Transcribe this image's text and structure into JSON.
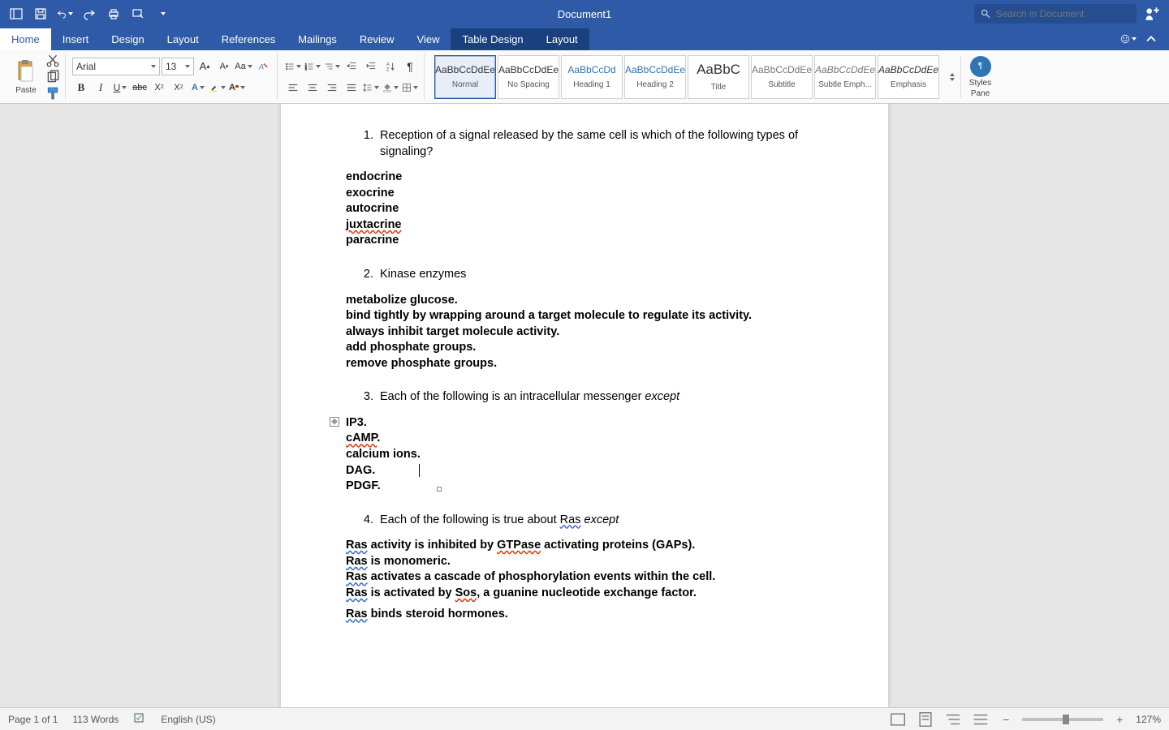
{
  "titlebar": {
    "document_title": "Document1",
    "search_placeholder": "Search in Document"
  },
  "tabs": {
    "home": "Home",
    "insert": "Insert",
    "design": "Design",
    "layout": "Layout",
    "references": "References",
    "mailings": "Mailings",
    "review": "Review",
    "view": "View",
    "table_design": "Table Design",
    "table_layout": "Layout"
  },
  "ribbon": {
    "paste_label": "Paste",
    "font_name": "Arial",
    "font_size": "13",
    "styles": [
      {
        "sample": "AaBbCcDdEe",
        "name": "Normal",
        "class": "",
        "selected": true
      },
      {
        "sample": "AaBbCcDdEe",
        "name": "No Spacing",
        "class": "",
        "selected": false
      },
      {
        "sample": "AaBbCcDd",
        "name": "Heading 1",
        "class": "h",
        "selected": false
      },
      {
        "sample": "AaBbCcDdEe",
        "name": "Heading 2",
        "class": "h",
        "selected": false
      },
      {
        "sample": "AaBbC",
        "name": "Title",
        "class": "title",
        "selected": false
      },
      {
        "sample": "AaBbCcDdEe",
        "name": "Subtitle",
        "class": "subtle",
        "selected": false
      },
      {
        "sample": "AaBbCcDdEe",
        "name": "Subtle Emph...",
        "class": "subem",
        "selected": false
      },
      {
        "sample": "AaBbCcDdEe",
        "name": "Emphasis",
        "class": "em",
        "selected": false
      }
    ],
    "styles_pane_label1": "Styles",
    "styles_pane_label2": "Pane"
  },
  "document": {
    "q1_num": "1.",
    "q1_text": "Reception of a signal released by the same cell is which of the following types of signaling?",
    "q1_a": [
      "endocrine",
      "exocrine",
      "autocrine",
      "juxtacrine",
      "paracrine"
    ],
    "q2_num": "2.",
    "q2_text": "Kinase enzymes",
    "q2_a": [
      "metabolize glucose.",
      "bind tightly by wrapping around a target molecule to regulate its activity.",
      "always inhibit target molecule activity.",
      "add phosphate groups.",
      "remove phosphate groups."
    ],
    "q3_num": "3.",
    "q3_pre": "Each of the following is an intracellular messenger ",
    "q3_em": "except",
    "q3_a": [
      "IP3.",
      "cAMP",
      ".",
      "calcium ions.",
      "DAG.",
      "PDGF."
    ],
    "q4_num": "4.",
    "q4_pre": "Each of the following is true about ",
    "q4_ras": "Ras",
    "q4_sp": " ",
    "q4_em": "except",
    "q4_a1a": "Ras",
    "q4_a1b": " activity is inhibited by ",
    "q4_a1c": "GTPase",
    "q4_a1d": " activating proteins (GAPs).",
    "q4_a2a": "Ras",
    "q4_a2b": " is monomeric.",
    "q4_a3a": "Ras",
    "q4_a3b": " activates a cascade of phosphorylation events within the cell.",
    "q4_a4a": "Ras",
    "q4_a4b": " is activated by ",
    "q4_a4c": "Sos",
    "q4_a4d": ", a guanine nucleotide exchange factor.",
    "q4_a5a": "Ras",
    "q4_a5b": " binds steroid hormones."
  },
  "statusbar": {
    "page": "Page 1 of 1",
    "words": "113 Words",
    "lang": "English (US)",
    "zoom": "127%"
  }
}
